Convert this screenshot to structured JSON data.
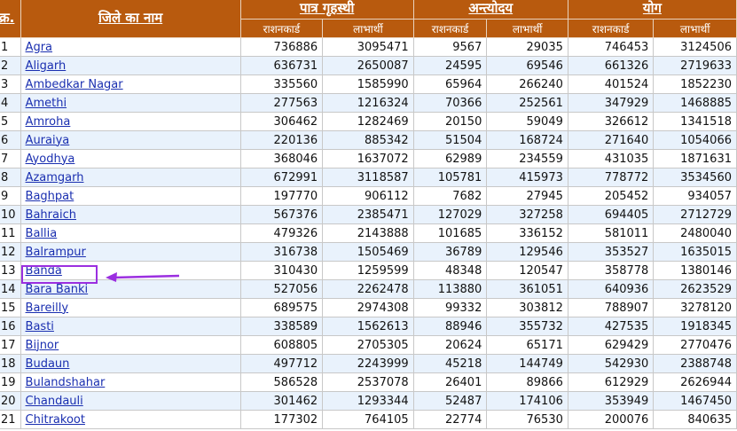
{
  "headers": {
    "serial": "क्र.",
    "district": "जिले का नाम",
    "groups": [
      "पात्र गृहस्थी",
      "अन्त्योदय",
      "योग"
    ],
    "sub": [
      "राशनकार्ड",
      "लाभार्थी",
      "राशनकार्ड",
      "लाभार्थी",
      "राशनकार्ड",
      "लाभार्थी"
    ]
  },
  "rows": [
    {
      "no": "1",
      "name": "Agra",
      "v": [
        "736886",
        "3095471",
        "9567",
        "29035",
        "746453",
        "3124506"
      ]
    },
    {
      "no": "2",
      "name": "Aligarh",
      "v": [
        "636731",
        "2650087",
        "24595",
        "69546",
        "661326",
        "2719633"
      ]
    },
    {
      "no": "3",
      "name": "Ambedkar Nagar",
      "v": [
        "335560",
        "1585990",
        "65964",
        "266240",
        "401524",
        "1852230"
      ]
    },
    {
      "no": "4",
      "name": "Amethi",
      "v": [
        "277563",
        "1216324",
        "70366",
        "252561",
        "347929",
        "1468885"
      ]
    },
    {
      "no": "5",
      "name": "Amroha",
      "v": [
        "306462",
        "1282469",
        "20150",
        "59049",
        "326612",
        "1341518"
      ]
    },
    {
      "no": "6",
      "name": "Auraiya",
      "v": [
        "220136",
        "885342",
        "51504",
        "168724",
        "271640",
        "1054066"
      ]
    },
    {
      "no": "7",
      "name": "Ayodhya",
      "v": [
        "368046",
        "1637072",
        "62989",
        "234559",
        "431035",
        "1871631"
      ]
    },
    {
      "no": "8",
      "name": "Azamgarh",
      "v": [
        "672991",
        "3118587",
        "105781",
        "415973",
        "778772",
        "3534560"
      ]
    },
    {
      "no": "9",
      "name": "Baghpat",
      "v": [
        "197770",
        "906112",
        "7682",
        "27945",
        "205452",
        "934057"
      ]
    },
    {
      "no": "10",
      "name": "Bahraich",
      "v": [
        "567376",
        "2385471",
        "127029",
        "327258",
        "694405",
        "2712729"
      ]
    },
    {
      "no": "11",
      "name": "Ballia",
      "v": [
        "479326",
        "2143888",
        "101685",
        "336152",
        "581011",
        "2480040"
      ]
    },
    {
      "no": "12",
      "name": "Balrampur",
      "v": [
        "316738",
        "1505469",
        "36789",
        "129546",
        "353527",
        "1635015"
      ]
    },
    {
      "no": "13",
      "name": "Banda",
      "v": [
        "310430",
        "1259599",
        "48348",
        "120547",
        "358778",
        "1380146"
      ]
    },
    {
      "no": "14",
      "name": "Bara Banki",
      "v": [
        "527056",
        "2262478",
        "113880",
        "361051",
        "640936",
        "2623529"
      ]
    },
    {
      "no": "15",
      "name": "Bareilly",
      "v": [
        "689575",
        "2974308",
        "99332",
        "303812",
        "788907",
        "3278120"
      ]
    },
    {
      "no": "16",
      "name": "Basti",
      "v": [
        "338589",
        "1562613",
        "88946",
        "355732",
        "427535",
        "1918345"
      ]
    },
    {
      "no": "17",
      "name": "Bijnor",
      "v": [
        "608805",
        "2705305",
        "20624",
        "65171",
        "629429",
        "2770476"
      ]
    },
    {
      "no": "18",
      "name": "Budaun",
      "v": [
        "497712",
        "2243999",
        "45218",
        "144749",
        "542930",
        "2388748"
      ]
    },
    {
      "no": "19",
      "name": "Bulandshahar",
      "v": [
        "586528",
        "2537078",
        "26401",
        "89866",
        "612929",
        "2626944"
      ]
    },
    {
      "no": "20",
      "name": "Chandauli",
      "v": [
        "301462",
        "1293344",
        "52487",
        "174106",
        "353949",
        "1467450"
      ]
    },
    {
      "no": "21",
      "name": "Chitrakoot",
      "v": [
        "177302",
        "764105",
        "22774",
        "76530",
        "200076",
        "840635"
      ]
    }
  ]
}
